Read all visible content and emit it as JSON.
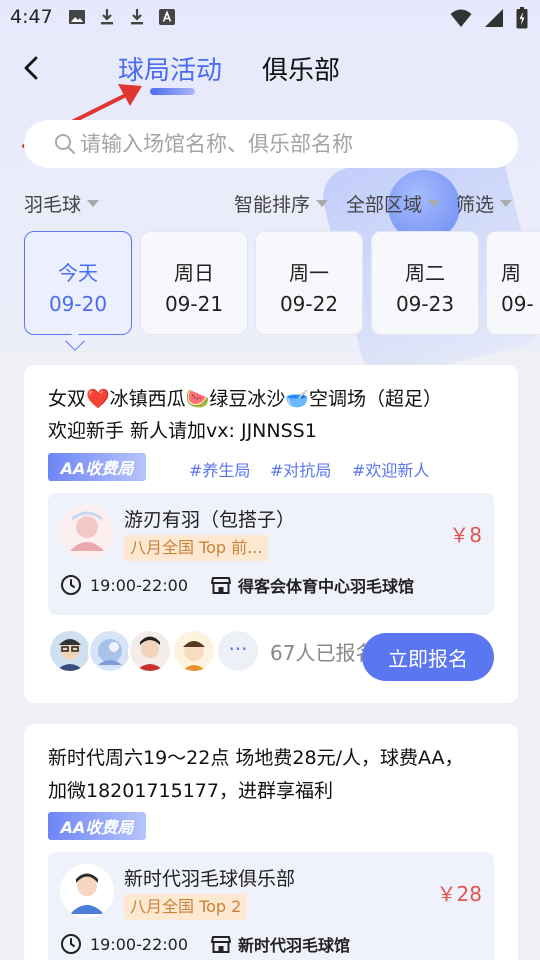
{
  "status_bar": {
    "time": "4:47",
    "left_icons": [
      "image-icon",
      "download-icon",
      "download-icon",
      "text-icon"
    ],
    "right_icons": [
      "wifi-icon",
      "signal-icon",
      "battery-icon"
    ]
  },
  "header": {
    "tabs": [
      {
        "label": "球局活动",
        "active": true
      },
      {
        "label": "俱乐部",
        "active": false
      }
    ]
  },
  "search": {
    "placeholder": "请输入场馆名称、俱乐部名称"
  },
  "filters": {
    "sport": "羽毛球",
    "sort": "智能排序",
    "region": "全部区域",
    "screen": "筛选"
  },
  "dates": [
    {
      "day": "今天",
      "date": "09-20",
      "active": true
    },
    {
      "day": "周日",
      "date": "09-21",
      "active": false
    },
    {
      "day": "周一",
      "date": "09-22",
      "active": false
    },
    {
      "day": "周二",
      "date": "09-23",
      "active": false
    },
    {
      "day": "周",
      "date": "09-",
      "active": false
    }
  ],
  "accent_color": "#5a76f0",
  "price_color": "#e0564f",
  "activities": [
    {
      "title_line1": "女双❤️冰镇西瓜🍉绿豆冰沙🥣空调场（超足）",
      "title_line2": "欢迎新手 新人请加vx: JJNNSS1",
      "badge": "AA收费局",
      "tags": [
        "#养生局",
        "#对抗局",
        "#欢迎新人"
      ],
      "club_name": "游刃有羽（包搭子）",
      "club_rank": "八月全国 Top 前...",
      "price": "￥8",
      "time": "19:00-22:00",
      "venue": "得客会体育中心羽毛球馆",
      "enrolled": "67人已报名",
      "more_label": "···",
      "signup_label": "立即报名"
    },
    {
      "title_line1": "新时代周六19～22点 场地费28元/人，球费AA，",
      "title_line2": "加微18201715177，进群享福利",
      "badge": "AA收费局",
      "club_name": "新时代羽毛球俱乐部",
      "club_rank": "八月全国 Top 2",
      "price": "￥28",
      "time": "19:00-22:00",
      "venue": "新时代羽毛球馆"
    }
  ]
}
